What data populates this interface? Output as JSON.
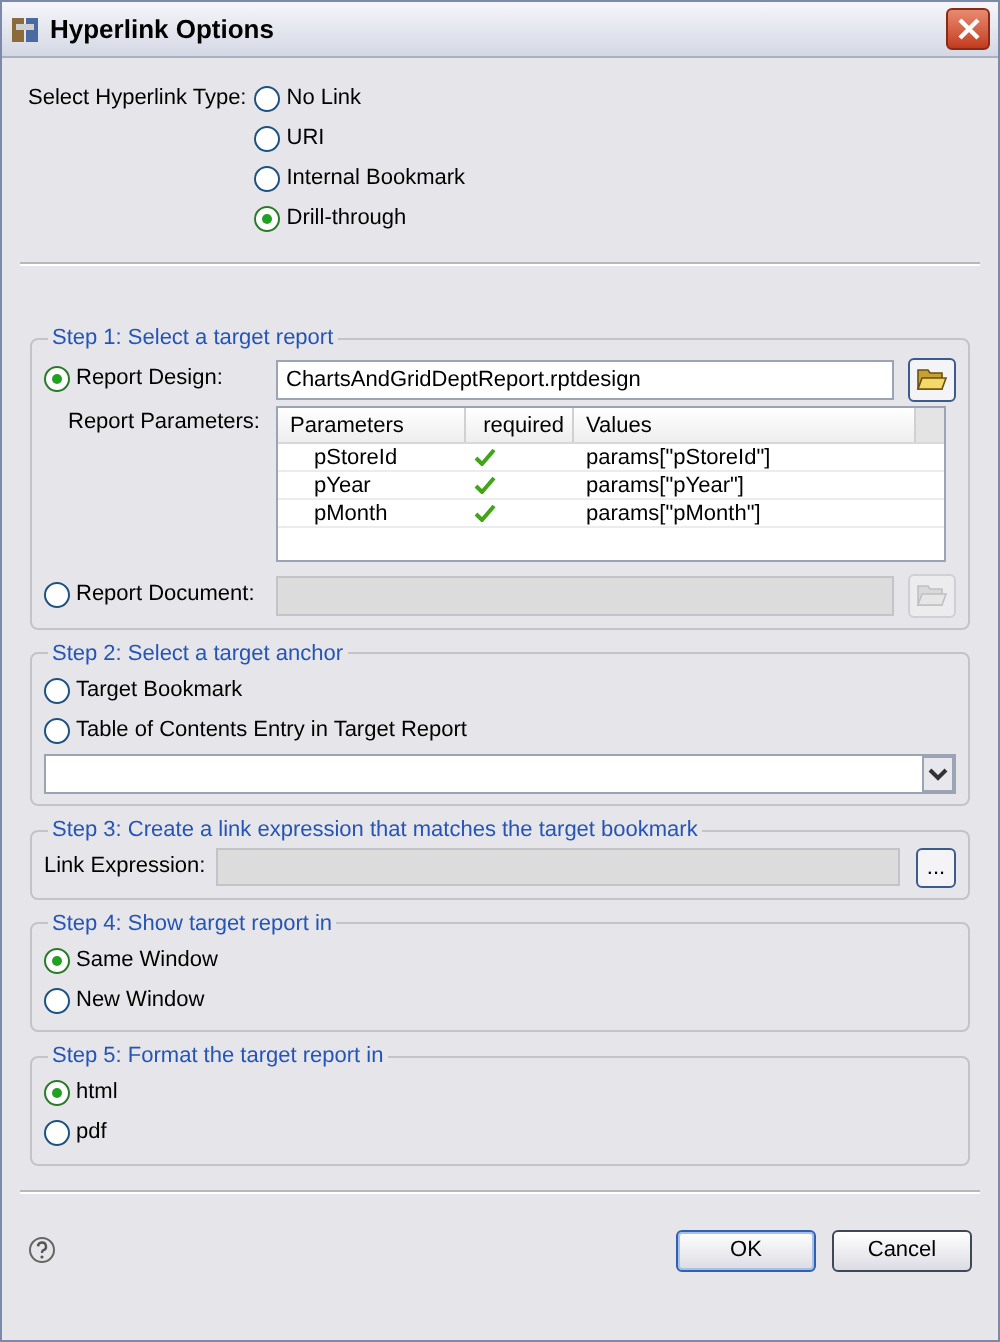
{
  "window": {
    "title": "Hyperlink Options"
  },
  "hyperlink_type": {
    "label": "Select Hyperlink Type:",
    "options": [
      {
        "label": "No Link",
        "selected": false
      },
      {
        "label": "URI",
        "selected": false
      },
      {
        "label": "Internal Bookmark",
        "selected": false
      },
      {
        "label": "Drill-through",
        "selected": true
      }
    ]
  },
  "step1": {
    "title": "Step 1: Select a target report",
    "report_design": {
      "label": "Report Design:",
      "selected": true,
      "value": "ChartsAndGridDeptReport.rptdesign"
    },
    "parameters": {
      "label": "Report Parameters:",
      "columns": [
        "Parameters",
        "required",
        "Values"
      ],
      "rows": [
        {
          "name": "pStoreId",
          "required": true,
          "value": "params[\"pStoreId\"]"
        },
        {
          "name": "pYear",
          "required": true,
          "value": "params[\"pYear\"]"
        },
        {
          "name": "pMonth",
          "required": true,
          "value": "params[\"pMonth\"]"
        }
      ]
    },
    "report_document": {
      "label": "Report Document:",
      "selected": false,
      "disabled": true
    }
  },
  "step2": {
    "title": "Step 2: Select a target anchor",
    "options": [
      {
        "label": "Target Bookmark",
        "selected": false
      },
      {
        "label": "Table of Contents Entry in Target Report",
        "selected": false
      }
    ]
  },
  "step3": {
    "title": "Step 3: Create a link expression that matches the target bookmark",
    "label": "Link Expression:",
    "disabled": true,
    "button": "..."
  },
  "step4": {
    "title": "Step 4: Show target report in",
    "options": [
      {
        "label": "Same Window",
        "selected": true
      },
      {
        "label": "New Window",
        "selected": false
      }
    ]
  },
  "step5": {
    "title": "Step 5: Format the target report in",
    "options": [
      {
        "label": "html",
        "selected": true
      },
      {
        "label": "pdf",
        "selected": false
      }
    ]
  },
  "buttons": [
    {
      "label": "OK",
      "default": true
    },
    {
      "label": "Cancel",
      "default": false
    }
  ]
}
